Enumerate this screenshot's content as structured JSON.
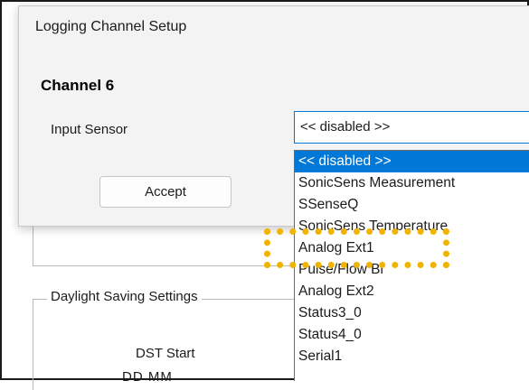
{
  "background": {
    "dst_group_label": "Daylight Saving Settings",
    "dst_start_label": "DST Start",
    "dst_format_text": "DD MM"
  },
  "dialog": {
    "title": "Logging Channel Setup",
    "channel_heading": "Channel 6",
    "input_sensor_label": "Input Sensor",
    "input_sensor_value": "<< disabled >>",
    "accept_label": "Accept"
  },
  "dropdown": {
    "items": [
      "<< disabled >>",
      "SonicSens Measurement",
      "SSenseQ",
      "SonicSens Temperature",
      "Analog Ext1",
      "Pulse/Flow Bi",
      "Analog Ext2",
      "Status3_0",
      "Status4_0",
      "Serial1"
    ],
    "selected_index": 0,
    "highlighted_item": "Analog Ext1"
  },
  "colors": {
    "selection": "#0078d7",
    "highlight_box": "#f0b400"
  }
}
